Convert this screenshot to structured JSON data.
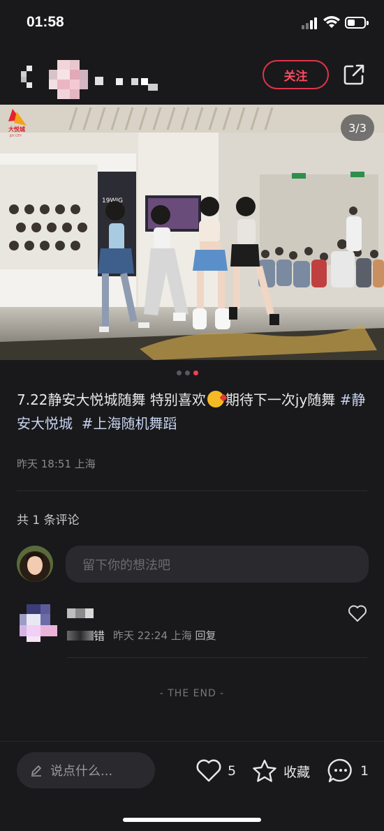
{
  "status": {
    "time": "01:58"
  },
  "header": {
    "follow_label": "关注"
  },
  "media": {
    "counter": "3/3",
    "logo_text": "大悦城",
    "logo_sub": "JOY CITY",
    "store_sign": "19WIG"
  },
  "caption": {
    "text_a": "7.22静安大悦城随舞 特别喜欢",
    "text_b": "期待下一次jy随舞 ",
    "tag_1": "#静安大悦城",
    "tag_2": "#上海随机舞蹈"
  },
  "post_meta": "昨天 18:51 上海",
  "comments": {
    "count_label": "共 1 条评论",
    "input_placeholder": "留下你的想法吧",
    "items": [
      {
        "text_tail": "错",
        "time_place": "昨天 22:24 上海 ",
        "reply_label": "回复"
      }
    ],
    "end_label": "- THE END -"
  },
  "bottom_bar": {
    "say_placeholder": "说点什么...",
    "likes_count": "5",
    "collect_label": "收藏",
    "comments_count": "1"
  },
  "colors": {
    "accent": "#ff3b50",
    "background": "#19191b",
    "tag": "#c7d3ef"
  }
}
